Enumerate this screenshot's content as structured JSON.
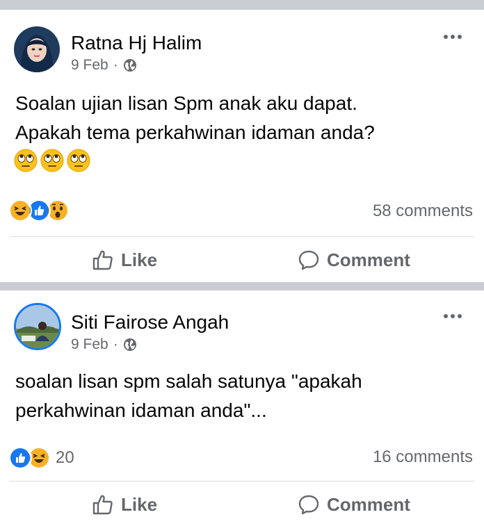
{
  "posts": [
    {
      "author": "Ratna Hj Halim",
      "date": "9 Feb",
      "dot": "·",
      "lines": [
        "Soalan ujian lisan Spm anak aku dapat.",
        "Apakah tema perkahwinan idaman anda?"
      ],
      "emoji": [
        "eye-roll",
        "eye-roll",
        "eye-roll"
      ],
      "reactions": [
        "haha",
        "like",
        "wow"
      ],
      "reaction_count": "",
      "comments": "58 comments",
      "like_label": "Like",
      "comment_label": "Comment"
    },
    {
      "author": "Siti Fairose Angah",
      "date": "9 Feb",
      "dot": "·",
      "lines": [
        "soalan lisan spm salah satunya \"apakah",
        "perkahwinan idaman anda\"..."
      ],
      "emoji": [],
      "reactions": [
        "like",
        "haha"
      ],
      "reaction_count": "20",
      "comments": "16 comments",
      "like_label": "Like",
      "comment_label": "Comment"
    }
  ],
  "colors": {
    "like_blue": "#1877f2",
    "haha_yellow": "#f7b125",
    "text_secondary": "#65676b",
    "separator": "#c9ccd1"
  }
}
